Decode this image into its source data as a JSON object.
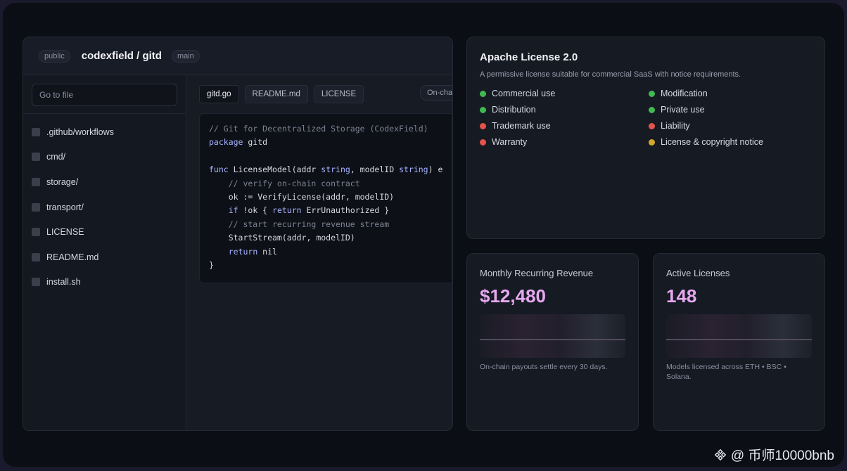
{
  "repo": {
    "visibility": "public",
    "name": "codexfield / gitd",
    "branch": "main",
    "search_placeholder": "Go to file",
    "files": [
      ".github/workflows",
      "cmd/",
      "storage/",
      "transport/",
      "LICENSE",
      "README.md",
      "install.sh"
    ],
    "tabs": [
      "gitd.go",
      "README.md",
      "LICENSE"
    ],
    "onchain_badge": "On-chain",
    "code_lines": [
      "// Git for Decentralized Storage (CodexField)",
      "package gitd",
      "",
      "func LicenseModel(addr string, modelID string) e",
      "    // verify on-chain contract",
      "    ok := VerifyLicense(addr, modelID)",
      "    if !ok { return ErrUnauthorized }",
      "    // start recurring revenue stream",
      "    StartStream(addr, modelID)",
      "    return nil",
      "}"
    ]
  },
  "license": {
    "title": "Apache License 2.0",
    "subtitle": "A permissive license suitable for commercial SaaS with notice requirements.",
    "permissions": [
      {
        "label": "Commercial use",
        "color": "#3fb950"
      },
      {
        "label": "Distribution",
        "color": "#3fb950"
      },
      {
        "label": "Trademark use",
        "color": "#e5534b"
      },
      {
        "label": "Warranty",
        "color": "#e5534b"
      },
      {
        "label": "Modification",
        "color": "#3fb950"
      },
      {
        "label": "Private use",
        "color": "#3fb950"
      },
      {
        "label": "Liability",
        "color": "#e5534b"
      },
      {
        "label": "License & copyright notice",
        "color": "#d4a72c"
      }
    ]
  },
  "stats": {
    "mrr": {
      "title": "Monthly Recurring Revenue",
      "value": "$12,480",
      "note": "On-chain payouts settle every 30 days."
    },
    "licenses": {
      "title": "Active Licenses",
      "value": "148",
      "note": "Models licensed across ETH • BSC • Solana."
    }
  },
  "watermark": {
    "icon": "binance-diamond-icon",
    "text": "@ 币师10000bnb"
  }
}
